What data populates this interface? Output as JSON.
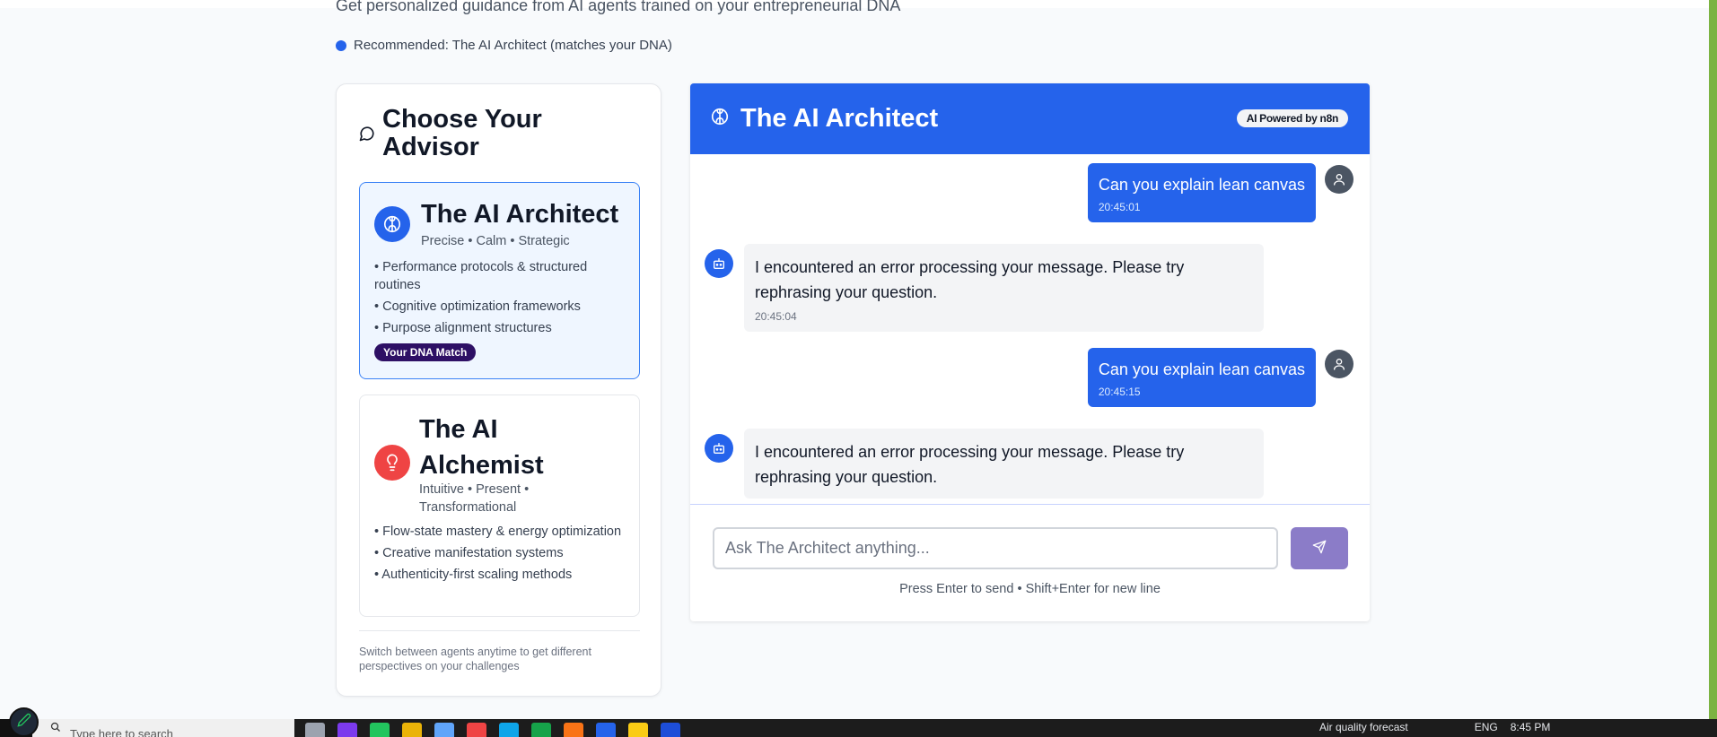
{
  "header": {
    "subtitle": "Get personalized guidance from AI agents trained on your entrepreneurial DNA",
    "recommendation": "Recommended: The AI Architect (matches your DNA)"
  },
  "advisor_panel": {
    "title": "Choose Your Advisor",
    "advisors": [
      {
        "name": "The AI Architect",
        "traits": "Precise • Calm • Strategic",
        "features": [
          "• Performance protocols & structured routines",
          "• Cognitive optimization frameworks",
          "• Purpose alignment structures"
        ],
        "badge": "Your DNA Match",
        "selected": true,
        "icon": "brain-icon",
        "color": "#2563eb"
      },
      {
        "name": "The AI Alchemist",
        "traits": "Intuitive • Present • Transformational",
        "features": [
          "• Flow-state mastery & energy optimization",
          "• Creative manifestation systems",
          "• Authenticity-first scaling methods"
        ],
        "selected": false,
        "icon": "lightbulb-icon",
        "color": "#ef4444"
      }
    ],
    "footer_note": "Switch between agents anytime to get different perspectives on your challenges"
  },
  "chat": {
    "title": "The AI Architect",
    "powered_badge": "AI Powered by n8n",
    "messages": [
      {
        "role": "user",
        "text": "Can you explain lean canvas",
        "time": "20:45:01"
      },
      {
        "role": "bot",
        "text": "I encountered an error processing your message. Please try rephrasing your question.",
        "time": "20:45:04"
      },
      {
        "role": "user",
        "text": "Can you explain lean canvas",
        "time": "20:45:15"
      },
      {
        "role": "bot",
        "text": "I encountered an error processing your message. Please try rephrasing your question.",
        "time": ""
      }
    ],
    "input_placeholder": "Ask The Architect anything...",
    "hint": "Press Enter to send • Shift+Enter for new line"
  },
  "taskbar": {
    "search_placeholder": "Type here to search",
    "weather": "Air quality forecast",
    "language": "ENG",
    "time": "8:45 PM"
  },
  "colors": {
    "primary": "#2563eb",
    "badge": "#2e1065",
    "send_button": "#8b7cc8",
    "alchemist": "#ef4444",
    "accent_strip": "#7cb342"
  }
}
